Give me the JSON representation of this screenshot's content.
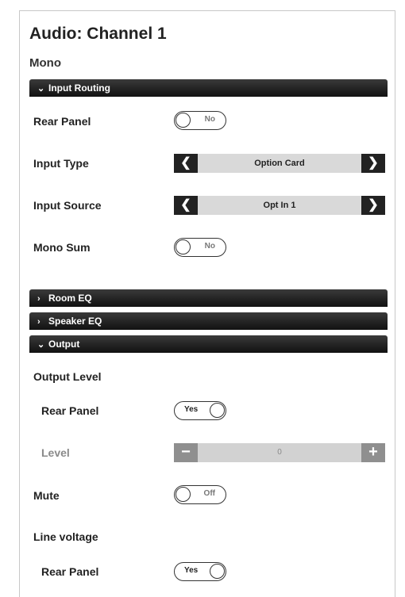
{
  "header": {
    "title": "Audio: Channel 1",
    "subtitle": "Mono"
  },
  "sections": {
    "input_routing": {
      "label": "Input Routing",
      "chevron": "⌄",
      "expanded": true
    },
    "room_eq": {
      "label": "Room EQ",
      "chevron": "›",
      "expanded": false
    },
    "speaker_eq": {
      "label": "Speaker EQ",
      "chevron": "›",
      "expanded": false
    },
    "output": {
      "label": "Output",
      "chevron": "⌄",
      "expanded": true
    }
  },
  "input_routing": {
    "rear_panel": {
      "label": "Rear Panel",
      "value": "No",
      "state": "off"
    },
    "input_type": {
      "label": "Input Type",
      "value": "Option Card"
    },
    "input_source": {
      "label": "Input Source",
      "value": "Opt In 1"
    },
    "mono_sum": {
      "label": "Mono Sum",
      "value": "No",
      "state": "off"
    }
  },
  "output": {
    "output_level_heading": "Output Level",
    "output_level_rear_panel": {
      "label": "Rear Panel",
      "value": "Yes",
      "state": "on"
    },
    "level": {
      "label": "Level",
      "value": "0",
      "disabled": true
    },
    "mute": {
      "label": "Mute",
      "value": "Off",
      "state": "off"
    },
    "line_voltage_heading": "Line voltage",
    "line_voltage_rear_panel": {
      "label": "Rear Panel",
      "value": "Yes",
      "state": "on"
    }
  },
  "controls": {
    "prev_glyph": "❮",
    "next_glyph": "❯",
    "minus_glyph": "−",
    "plus_glyph": "+"
  },
  "colors": {
    "section_bar": "#1a1a1a",
    "selector_bg": "#d9d9d9",
    "disabled_text": "#8a8a8a"
  }
}
